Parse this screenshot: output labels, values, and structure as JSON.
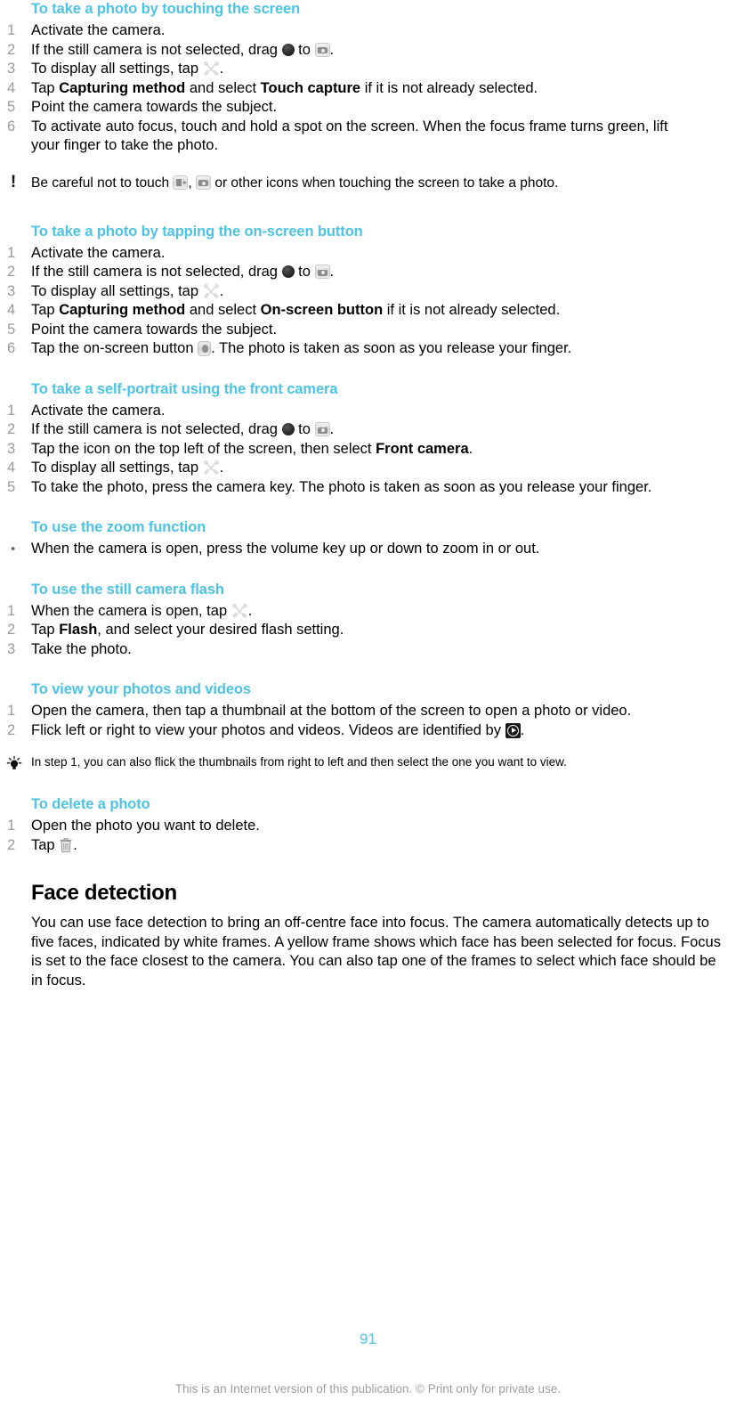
{
  "page": {
    "number": "91",
    "footer_note": "This is an Internet version of this publication. © Print only for private use.",
    "accent_color": "#4CC3E4",
    "number_color": "#9a9a9a",
    "footer_color": "#9e9e9e"
  },
  "sections": {
    "touch_screen": {
      "heading": "To take a photo by touching the screen",
      "steps": [
        {
          "num": "1",
          "text": "Activate the camera."
        },
        {
          "num": "2",
          "pre": "If the still camera is not selected, drag ",
          "icon1": "mode-knob-icon",
          "mid": " to ",
          "icon2": "still-camera-icon",
          "post": "."
        },
        {
          "num": "3",
          "pre": "To display all settings, tap ",
          "icon1": "settings-tools-icon",
          "post": "."
        },
        {
          "num": "4",
          "pre": "Tap ",
          "b1": "Capturing method",
          "mid": " and select ",
          "b2": "Touch capture",
          "post": " if it is not already selected."
        },
        {
          "num": "5",
          "text": "Point the camera towards the subject."
        },
        {
          "num": "6",
          "text": "To activate auto focus, touch and hold a spot on the screen. When the focus frame turns green, lift your finger to take the photo."
        }
      ]
    },
    "note": {
      "icon": "exclamation-icon",
      "pre": "Be careful not to touch ",
      "icon1": "video-camera-icon",
      "mid": ", ",
      "icon2": "still-camera-icon",
      "post": " or other icons when touching the screen to take a photo."
    },
    "on_screen_button": {
      "heading": "To take a photo by tapping the on-screen button",
      "steps": [
        {
          "num": "1",
          "text": "Activate the camera."
        },
        {
          "num": "2",
          "pre": "If the still camera is not selected, drag ",
          "icon1": "mode-knob-icon",
          "mid": " to ",
          "icon2": "still-camera-icon",
          "post": "."
        },
        {
          "num": "3",
          "pre": "To display all settings, tap ",
          "icon1": "settings-tools-icon",
          "post": "."
        },
        {
          "num": "4",
          "pre": "Tap ",
          "b1": "Capturing method",
          "mid": " and select ",
          "b2": "On-screen button",
          "post": " if it is not already selected."
        },
        {
          "num": "5",
          "text": "Point the camera towards the subject."
        },
        {
          "num": "6",
          "pre": "Tap the on-screen button ",
          "icon1": "on-screen-shutter-icon",
          "post": ". The photo is taken as soon as you release your finger."
        }
      ]
    },
    "self_portrait": {
      "heading": "To take a self-portrait using the front camera",
      "steps": [
        {
          "num": "1",
          "text": "Activate the camera."
        },
        {
          "num": "2",
          "pre": "If the still camera is not selected, drag ",
          "icon1": "mode-knob-icon",
          "mid": " to ",
          "icon2": "still-camera-icon",
          "post": "."
        },
        {
          "num": "3",
          "pre": "Tap the icon on the top left of the screen, then select ",
          "b1": "Front camera",
          "post": "."
        },
        {
          "num": "4",
          "pre": "To display all settings, tap ",
          "icon1": "settings-tools-icon",
          "post": "."
        },
        {
          "num": "5",
          "text": "To take the photo, press the camera key. The photo is taken as soon as you release your finger."
        }
      ]
    },
    "zoom_function": {
      "heading": "To use the zoom function",
      "bullet": "•",
      "items": [
        {
          "text": "When the camera is open, press the volume key up or down to zoom in or out."
        }
      ]
    },
    "still_camera_flash": {
      "heading": "To use the still camera flash",
      "steps": [
        {
          "num": "1",
          "pre": "When the camera is open, tap ",
          "icon1": "settings-tools-icon",
          "post": "."
        },
        {
          "num": "2",
          "pre": "Tap ",
          "b1": "Flash",
          "post": ", and select your desired flash setting."
        },
        {
          "num": "3",
          "text": "Take the photo."
        }
      ]
    },
    "view_photos_videos": {
      "heading": "To view your photos and videos",
      "steps": [
        {
          "num": "1",
          "text": "Open the camera, then tap a thumbnail at the bottom of the screen to open a photo or video."
        },
        {
          "num": "2",
          "pre": "Flick left or right to view your photos and videos. Videos are identified by ",
          "icon1": "video-play-icon",
          "post": "."
        }
      ]
    },
    "tip": {
      "icon": "light-bulb-tip-icon",
      "text": "In step 1, you can also flick the thumbnails from right to left and then select the one you want to view."
    },
    "delete_photo": {
      "heading": "To delete a photo",
      "steps": [
        {
          "num": "1",
          "text": "Open the photo you want to delete."
        },
        {
          "num": "2",
          "pre": "Tap ",
          "icon1": "trash-can-icon",
          "post": "."
        }
      ]
    },
    "face_detection": {
      "heading": "Face detection",
      "paragraph": "You can use face detection to bring an off-centre face into focus. The camera automatically detects up to five faces, indicated by white frames. A yellow frame shows which face has been selected for focus. Focus is set to the face closest to the camera. You can also tap one of the frames to select which face should be in focus."
    }
  }
}
